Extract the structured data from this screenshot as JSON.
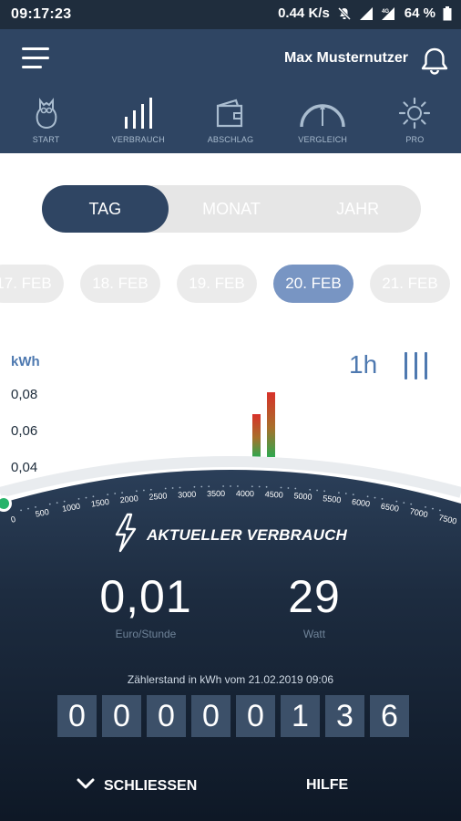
{
  "status": {
    "time": "09:17:23",
    "speed": "0.44 K/s",
    "battery": "64 %"
  },
  "header": {
    "username": "Max Musternutzer"
  },
  "nav": [
    {
      "label": "START",
      "icon": "owl-icon"
    },
    {
      "label": "VERBRAUCH",
      "icon": "bars-chart-icon"
    },
    {
      "label": "ABSCHLAG",
      "icon": "wallet-icon"
    },
    {
      "label": "VERGLEICH",
      "icon": "gauge-icon"
    },
    {
      "label": "PRO",
      "icon": "sun-icon"
    }
  ],
  "segment": {
    "items": [
      "TAG",
      "MONAT",
      "JAHR"
    ],
    "active": "TAG"
  },
  "dates": [
    "17. FEB",
    "18. FEB",
    "19. FEB",
    "20. FEB",
    "21. FEB"
  ],
  "active_date": "20. FEB",
  "chart": {
    "unit": "kWh",
    "yticks": [
      "0,08",
      "0,06",
      "0,04"
    ],
    "resolution": "1h",
    "bars": [
      0.069,
      0.081
    ]
  },
  "gauge": {
    "ticks": [
      "0",
      "500",
      "1000",
      "1500",
      "2000",
      "2500",
      "3000",
      "3500",
      "4000",
      "4500",
      "5000",
      "5500",
      "6000",
      "6500",
      "7000",
      "7500"
    ],
    "value_watt": 29,
    "title": "AKTUELLER VERBRAUCH"
  },
  "metrics": {
    "cost_value": "0,01",
    "cost_unit": "Euro/Stunde",
    "power_value": "29",
    "power_unit": "Watt"
  },
  "meter": {
    "label": "Zählerstand in kWh vom 21.02.2019 09:06",
    "digits": [
      "0",
      "0",
      "0",
      "0",
      "0",
      "1",
      "3",
      "6"
    ]
  },
  "footer": {
    "close": "SCHLIESSEN",
    "help": "HILFE"
  },
  "colors": {
    "navy": "#2f4563",
    "accent_blue": "#4e79b0",
    "active_chip": "#7895c3",
    "gauge_dot": "#27b36a"
  }
}
